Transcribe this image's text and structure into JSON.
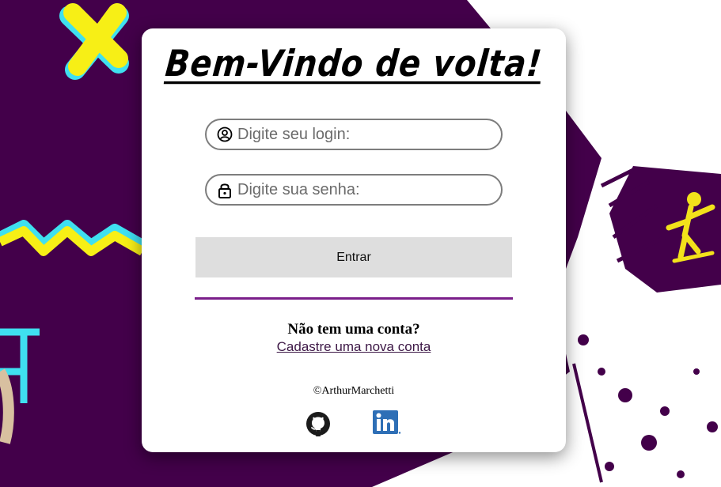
{
  "title": "Bem-Vindo de volta!",
  "login": {
    "placeholder": "Digite seu login:",
    "icon": "user-circle-icon"
  },
  "password": {
    "placeholder": "Digite sua senha:",
    "icon": "lock-icon"
  },
  "submit_label": "Entrar",
  "signup": {
    "question": "Não tem uma conta?",
    "link_label": "Cadastre uma nova conta"
  },
  "footer": {
    "copyright": "©ArthurMarchetti",
    "icons": [
      "github-icon",
      "linkedin-icon"
    ]
  },
  "colors": {
    "background": "#43004a",
    "divider": "#7a1e8a",
    "button": "#dedede",
    "linkedin": "#2e6fb6",
    "graffiti_yellow": "#f7ef16",
    "graffiti_cyan": "#3fe0f0"
  }
}
